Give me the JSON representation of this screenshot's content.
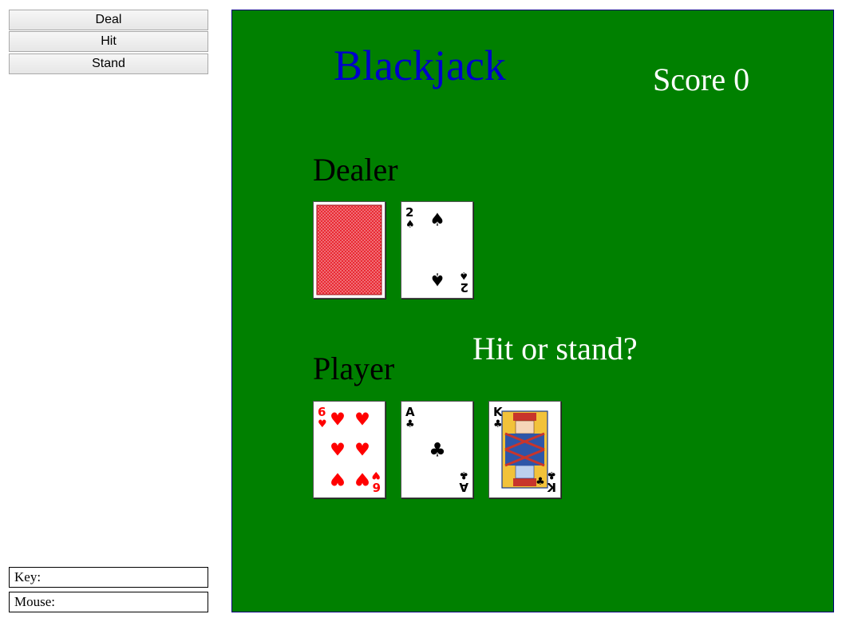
{
  "controls": {
    "deal_label": "Deal",
    "hit_label": "Hit",
    "stand_label": "Stand"
  },
  "status": {
    "key_label": "Key:",
    "key_value": "",
    "mouse_label": "Mouse:",
    "mouse_value": ""
  },
  "game": {
    "title": "Blackjack",
    "score_text": "Score 0",
    "dealer_label": "Dealer",
    "player_label": "Player",
    "message": "Hit or stand?",
    "dealer_cards": [
      {
        "rank": "",
        "suit": "",
        "face_down": true
      },
      {
        "rank": "2",
        "suit": "spades",
        "face_down": false
      }
    ],
    "player_cards": [
      {
        "rank": "6",
        "suit": "hearts",
        "face_down": false
      },
      {
        "rank": "A",
        "suit": "clubs",
        "face_down": false
      },
      {
        "rank": "K",
        "suit": "clubs",
        "face_down": false
      }
    ]
  },
  "colors": {
    "table_green": "#008000",
    "title_blue": "#0000cc",
    "score_white": "#ffffff",
    "label_black": "#000000",
    "card_back_red": "#e8202a",
    "hearts_red": "#ff0000",
    "black_suit": "#000000"
  }
}
